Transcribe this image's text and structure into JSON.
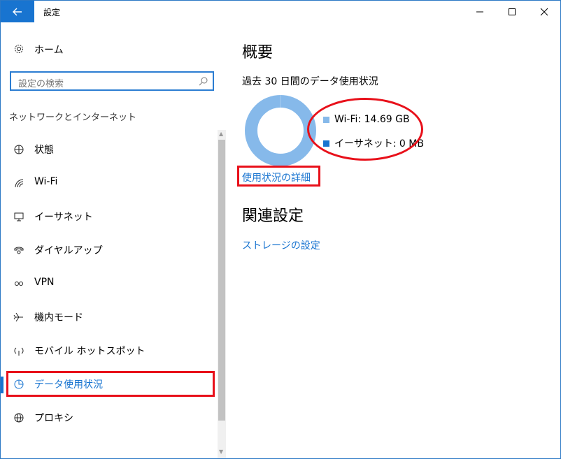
{
  "window": {
    "title": "設定"
  },
  "sidebar": {
    "home_label": "ホーム",
    "search_placeholder": "設定の検索",
    "section_title": "ネットワークとインターネット",
    "items": [
      {
        "label": "状態",
        "icon": "globe-status-icon",
        "active": false
      },
      {
        "label": "Wi-Fi",
        "icon": "wifi-icon",
        "active": false
      },
      {
        "label": "イーサネット",
        "icon": "ethernet-icon",
        "active": false
      },
      {
        "label": "ダイヤルアップ",
        "icon": "dialup-icon",
        "active": false
      },
      {
        "label": "VPN",
        "icon": "vpn-icon",
        "active": false
      },
      {
        "label": "機内モード",
        "icon": "airplane-icon",
        "active": false
      },
      {
        "label": "モバイル ホットスポット",
        "icon": "hotspot-icon",
        "active": false
      },
      {
        "label": "データ使用状況",
        "icon": "pie-chart-icon",
        "active": true
      },
      {
        "label": "プロキシ",
        "icon": "globe-icon",
        "active": false
      }
    ]
  },
  "main": {
    "heading": "概要",
    "subheading": "過去 30 日間のデータ使用状況",
    "legend": [
      {
        "label": "Wi-Fi: 14.69 GB",
        "color": "#86b9ea"
      },
      {
        "label": "イーサネット: 0 MB",
        "color": "#1874d0"
      }
    ],
    "details_link": "使用状況の詳細",
    "related_heading": "関連設定",
    "storage_link": "ストレージの設定"
  },
  "colors": {
    "accent": "#1874d0",
    "annotation": "#e8101a"
  }
}
